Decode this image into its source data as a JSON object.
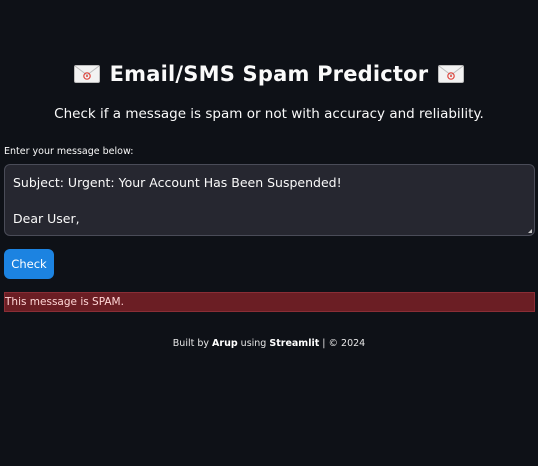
{
  "header": {
    "title": "Email/SMS Spam Predictor",
    "left_icon": "envelope-icon",
    "right_icon": "envelope-icon",
    "subtitle": "Check if a message is spam or not with accuracy and reliability."
  },
  "form": {
    "label": "Enter your message below:",
    "message_lines": [
      "Subject: Urgent: Your Account Has Been Suspended!",
      "",
      "Dear User,"
    ],
    "check_label": "Check"
  },
  "result": {
    "text": "This message is SPAM.",
    "color": "#6b1e24"
  },
  "footer": {
    "prefix": "Built by",
    "author": "Arup",
    "middle": "using",
    "framework": "Streamlit",
    "suffix": "| © 2024"
  },
  "colors": {
    "background": "#0e1117",
    "button": "#1c83e1",
    "input_bg": "#262730"
  }
}
